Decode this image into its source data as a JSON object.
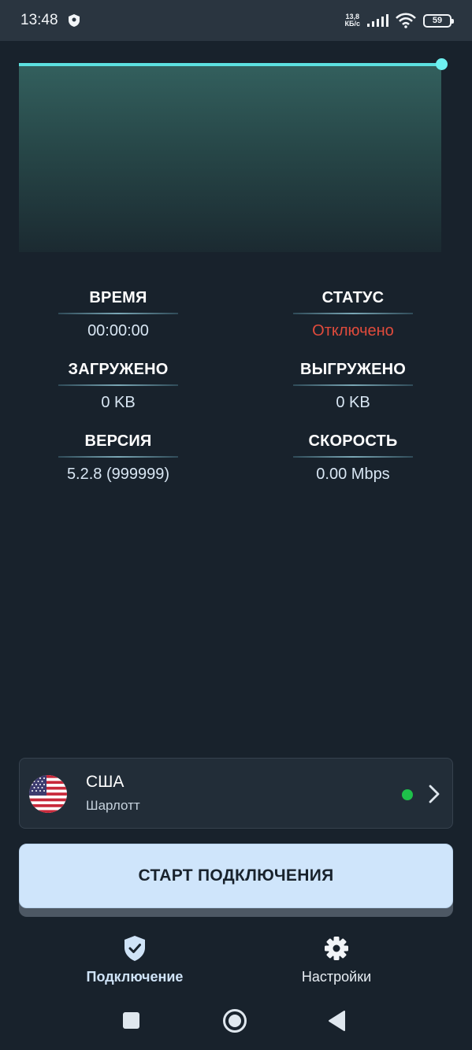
{
  "status_bar": {
    "time": "13:48",
    "net_speed_value": "13,8",
    "net_speed_unit": "КБ/с",
    "battery": "59",
    "icons": [
      "shield-icon",
      "signal-icon",
      "wifi-icon",
      "battery-icon"
    ]
  },
  "graph": {
    "accent": "#5ce0e0"
  },
  "stats": {
    "time_label": "ВРЕМЯ",
    "time_value": "00:00:00",
    "status_label": "СТАТУС",
    "status_value": "Отключено",
    "downloaded_label": "ЗАГРУЖЕНО",
    "downloaded_value": "0 KB",
    "uploaded_label": "ВЫГРУЖЕНО",
    "uploaded_value": "0 KB",
    "version_label": "ВЕРСИЯ",
    "version_value": "5.2.8 (999999)",
    "speed_label": "СКОРОСТЬ",
    "speed_value": "0.00 Mbps"
  },
  "server": {
    "country": "США",
    "city": "Шарлотт",
    "flag_icon": "us-flag-icon",
    "online_color": "#1ec04a"
  },
  "connect_button": {
    "label": "СТАРТ ПОДКЛЮЧЕНИЯ"
  },
  "bottom_nav": {
    "items": [
      {
        "label": "Подключение",
        "icon": "shield-check-icon",
        "active": true
      },
      {
        "label": "Настройки",
        "icon": "gear-icon",
        "active": false
      }
    ]
  },
  "colors": {
    "background": "#18222c",
    "status_off": "#e04b3c",
    "button": "#cfe5fb"
  }
}
